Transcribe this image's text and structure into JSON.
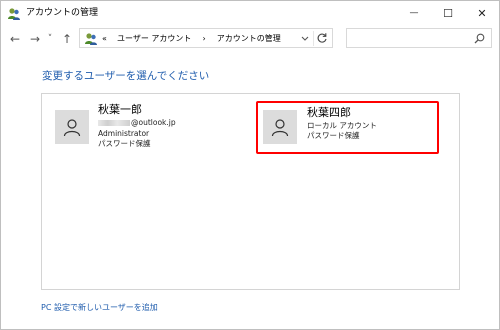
{
  "window": {
    "title": "アカウントの管理",
    "minimize_glyph": "—",
    "maximize_glyph": "☐",
    "close_glyph": "✕"
  },
  "navigation": {
    "back_glyph": "←",
    "forward_glyph": "→",
    "recent_glyph": "˅",
    "up_glyph": "↑",
    "address": {
      "prefix": "«",
      "crumb_1": "ユーザー アカウント",
      "separator": "›",
      "crumb_2": "アカウントの管理"
    },
    "search_placeholder": ""
  },
  "main": {
    "heading": "変更するユーザーを選んでください",
    "users": [
      {
        "name": "秋葉一郎",
        "email_visible": "@outlook.jp",
        "role": "Administrator",
        "protection": "パスワード保護"
      },
      {
        "name": "秋葉四郎",
        "type": "ローカル アカウント",
        "protection": "パスワード保護",
        "highlighted": true
      }
    ],
    "add_user_link": "PC 設定で新しいユーザーを追加"
  },
  "colors": {
    "accent_link": "#1f5cad",
    "highlight_border": "#ff0000",
    "avatar_bg": "#dcdcdc"
  },
  "icons": [
    "user-accounts-icon",
    "back-arrow-icon",
    "forward-arrow-icon",
    "chevron-down-icon",
    "up-arrow-icon",
    "refresh-icon",
    "search-icon",
    "user-avatar-icon"
  ]
}
